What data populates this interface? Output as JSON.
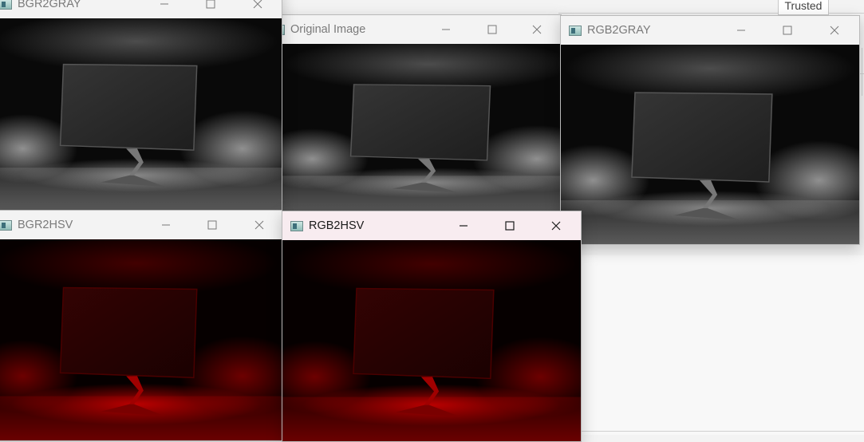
{
  "background_app": {
    "trusted_label": "Trusted"
  },
  "windows": {
    "bgr2gray": {
      "title": "BGR2GRAY",
      "image_tone": "grayscale"
    },
    "original": {
      "title": "Original Image",
      "image_tone": "grayscale"
    },
    "rgb2gray": {
      "title": "RGB2GRAY",
      "image_tone": "grayscale"
    },
    "bgr2hsv": {
      "title": "BGR2HSV",
      "image_tone": "red"
    },
    "rgb2hsv": {
      "title": "RGB2HSV",
      "image_tone": "red",
      "active": true
    }
  },
  "colors": {
    "active_titlebar": "#f8ecf0",
    "inactive_titlebar": "#f3f3f3",
    "hsv_red": "#c00000"
  },
  "icons": [
    "app-icon",
    "minimize-icon",
    "maximize-icon",
    "close-icon"
  ]
}
